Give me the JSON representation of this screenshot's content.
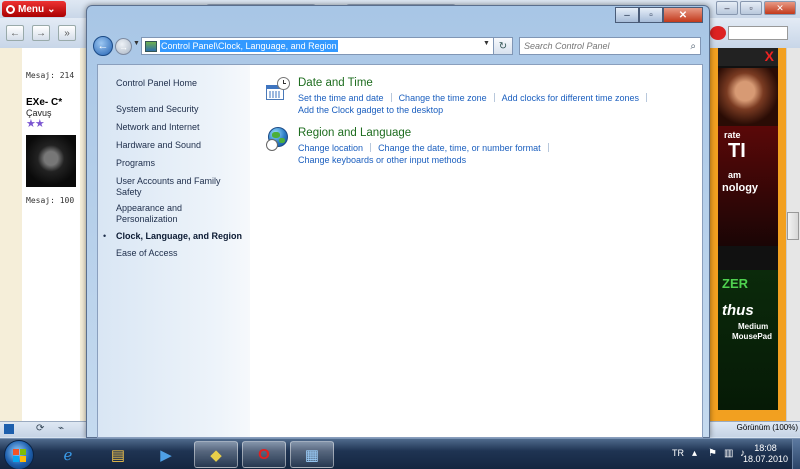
{
  "opera": {
    "menu_label": "Menu",
    "forum": {
      "mesaj_1": "Mesaj: 214",
      "username": "EXe- C*",
      "rank": "Çavuş",
      "stars": "★★",
      "mesaj_2": "Mesaj: 100"
    },
    "ad": {
      "top_text": "X",
      "mid_letters": "TI",
      "mid_text_1": "rate",
      "mid_text_2": "am",
      "mid_text_3": "nology",
      "green_1": "ZER",
      "green_2": "thus",
      "green_3": "Medium",
      "green_4": "MousePad"
    },
    "zoom_label": "Görünüm (100%)"
  },
  "window": {
    "buttons": {
      "minimize": "–",
      "maximize": "▫",
      "close": "✕"
    },
    "address": {
      "path": "Control Panel\\Clock, Language, and Region",
      "search_placeholder": "Search Control Panel"
    },
    "left_nav": {
      "home": "Control Panel Home",
      "items": [
        "System and Security",
        "Network and Internet",
        "Hardware and Sound",
        "Programs",
        "User Accounts and Family Safety",
        "Appearance and Personalization",
        "Clock, Language, and Region",
        "Ease of Access"
      ]
    },
    "categories": [
      {
        "title": "Date and Time",
        "links_row1": [
          "Set the time and date",
          "Change the time zone",
          "Add clocks for different time zones"
        ],
        "links_row2": [
          "Add the Clock gadget to the desktop"
        ]
      },
      {
        "title": "Region and Language",
        "links_row1": [
          "Change location",
          "Change the date, time, or number format"
        ],
        "links_row2": [
          "Change keyboards or other input methods"
        ]
      }
    ]
  },
  "taskbar": {
    "language": "TR",
    "time": "18:08",
    "date": "18.07.2010"
  }
}
